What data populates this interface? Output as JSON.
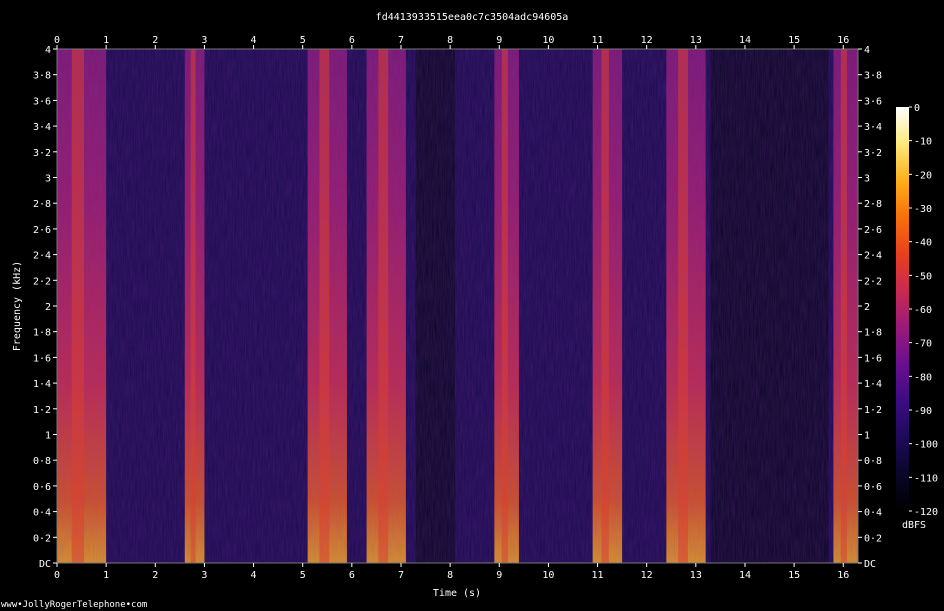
{
  "chart_data": {
    "type": "heatmap",
    "title": "fd4413933515eea0c7c3504adc94605a",
    "xlabel": "Time (s)",
    "ylabel": "Frequency (kHz)",
    "colorbar_label": "dBFS",
    "x_ticks": [
      "0",
      "1",
      "2",
      "3",
      "4",
      "5",
      "6",
      "7",
      "8",
      "9",
      "10",
      "11",
      "12",
      "13",
      "14",
      "15",
      "16"
    ],
    "y_ticks": [
      "DC",
      "0·2",
      "0·4",
      "0·6",
      "0·8",
      "1",
      "1·2",
      "1·4",
      "1·6",
      "1·8",
      "2",
      "2·2",
      "2·4",
      "2·6",
      "2·8",
      "3",
      "3·2",
      "3·4",
      "3·6",
      "3·8",
      "4"
    ],
    "xlim": [
      0,
      16.3
    ],
    "ylim": [
      0,
      4
    ],
    "colorbar_ticks": [
      "0",
      "-10",
      "-20",
      "-30",
      "-40",
      "-50",
      "-60",
      "-70",
      "-80",
      "-90",
      "-100",
      "-110",
      "-120"
    ],
    "colorbar_range": [
      -120,
      0
    ],
    "colormap": [
      "#000000",
      "#0a0628",
      "#1e0a5a",
      "#3c0c82",
      "#6a0f8e",
      "#9a1a7a",
      "#c82a52",
      "#e8401e",
      "#f8700a",
      "#fcb01a",
      "#fde97a",
      "#ffffff"
    ],
    "energy_bands_s": [
      [
        0,
        1
      ],
      [
        2.6,
        3
      ],
      [
        5.1,
        5.9
      ],
      [
        6.3,
        7.1
      ],
      [
        8.9,
        9.4
      ],
      [
        10.9,
        11.5
      ],
      [
        12.4,
        13.2
      ],
      [
        15.8,
        16.3
      ]
    ],
    "quiet_bands_s": [
      [
        7.3,
        8.1
      ],
      [
        13.3,
        15.7
      ]
    ]
  },
  "footer": "www•JollyRogerTelephone•com"
}
